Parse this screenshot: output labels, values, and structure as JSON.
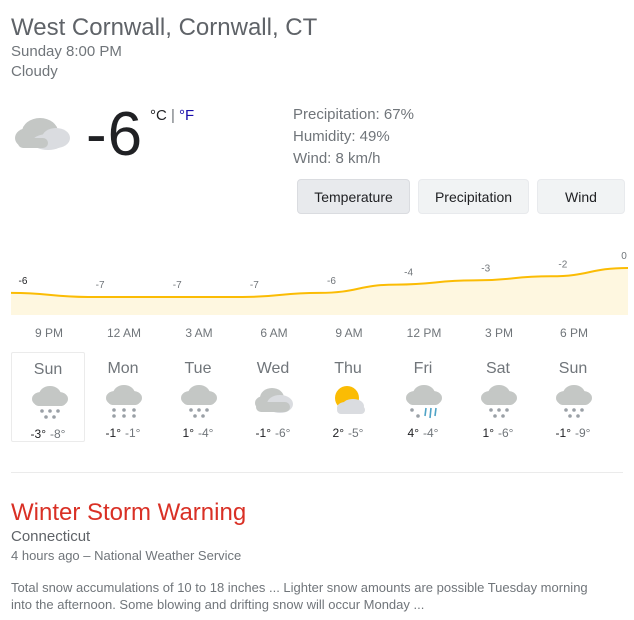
{
  "header": {
    "location": "West Cornwall, Cornwall, CT",
    "datetime": "Sunday 8:00 PM",
    "condition": "Cloudy"
  },
  "current": {
    "temp": "-6",
    "unit_c": "°C",
    "unit_sep": "|",
    "unit_f": "°F",
    "icon": "cloudy-icon"
  },
  "details": {
    "precipitation": "Precipitation: 67%",
    "humidity": "Humidity: 49%",
    "wind": "Wind: 8 km/h"
  },
  "tabs": [
    "Temperature",
    "Precipitation",
    "Wind"
  ],
  "active_tab": "Temperature",
  "chart_data": {
    "type": "area",
    "x": [
      "9 PM",
      "12 AM",
      "3 AM",
      "6 AM",
      "9 AM",
      "12 PM",
      "3 PM",
      "6 PM"
    ],
    "values": [
      -6,
      -7,
      -7,
      -7,
      -6,
      -4,
      -3,
      -2,
      0
    ],
    "point_labels": [
      "-6",
      "-7",
      "-7",
      "-7",
      "-6",
      "-4",
      "-3",
      "-2",
      "0"
    ],
    "colors": {
      "line": "#fbbc04",
      "fill": "#fef7e0"
    }
  },
  "forecast": [
    {
      "day": "Sun",
      "hi": "-3°",
      "lo": "-8°",
      "icon": "snow-icon"
    },
    {
      "day": "Mon",
      "hi": "-1°",
      "lo": "-1°",
      "icon": "heavy-snow-icon"
    },
    {
      "day": "Tue",
      "hi": "1°",
      "lo": "-4°",
      "icon": "snow-icon"
    },
    {
      "day": "Wed",
      "hi": "-1°",
      "lo": "-6°",
      "icon": "cloudy-icon"
    },
    {
      "day": "Thu",
      "hi": "2°",
      "lo": "-5°",
      "icon": "partly-cloudy-icon"
    },
    {
      "day": "Fri",
      "hi": "4°",
      "lo": "-4°",
      "icon": "rain-and-snow-icon"
    },
    {
      "day": "Sat",
      "hi": "1°",
      "lo": "-6°",
      "icon": "snow-icon"
    },
    {
      "day": "Sun",
      "hi": "-1°",
      "lo": "-9°",
      "icon": "snow-icon"
    }
  ],
  "alert": {
    "title": "Winter Storm Warning",
    "region": "Connecticut",
    "source": "4 hours ago – National Weather Service",
    "body": "Total snow accumulations of 10 to 18 inches ... Lighter snow amounts are possible Tuesday morning into the afternoon. Some blowing and drifting snow will occur Monday ..."
  }
}
